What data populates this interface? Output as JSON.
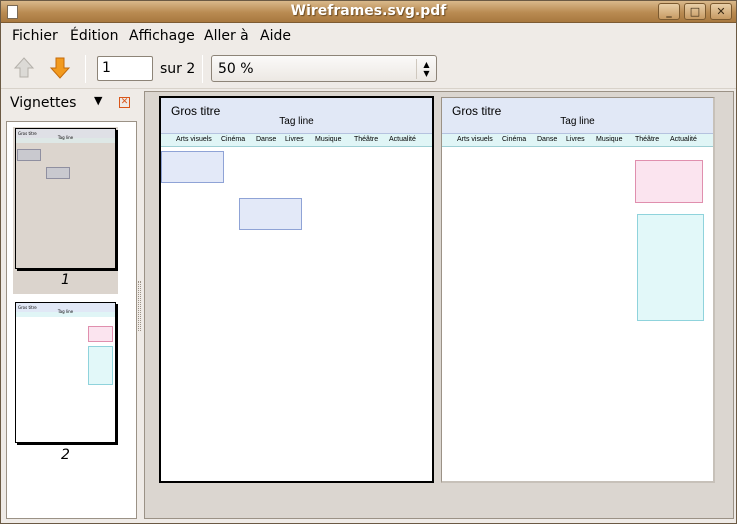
{
  "window": {
    "title": "Wireframes.svg.pdf",
    "controls": {
      "minimize": "_",
      "maximize": "□",
      "close": "✕"
    }
  },
  "menubar": {
    "items": [
      {
        "label": "Fichier"
      },
      {
        "label": "Édition"
      },
      {
        "label": "Affichage"
      },
      {
        "label": "Aller à"
      },
      {
        "label": "Aide"
      }
    ]
  },
  "toolbar": {
    "prev_icon": "up-arrow-icon",
    "next_icon": "down-arrow-icon",
    "page_value": "1",
    "page_total": "sur 2",
    "zoom_value": "50 %"
  },
  "sidebar": {
    "title": "Vignettes",
    "thumbnails": [
      {
        "number": "1",
        "selected": true
      },
      {
        "number": "2",
        "selected": false
      }
    ]
  },
  "document": {
    "pages": [
      {
        "title": "Gros titre",
        "tagline": "Tag line",
        "nav": [
          "Arts visuels",
          "Cinéma",
          "Danse",
          "Livres",
          "Musique",
          "Théâtre",
          "Actualité"
        ]
      },
      {
        "title": "Gros titre",
        "tagline": "Tag line",
        "nav": [
          "Arts visuels",
          "Cinéma",
          "Danse",
          "Livres",
          "Musique",
          "Théâtre",
          "Actualité"
        ]
      }
    ]
  },
  "colors": {
    "titlebar": "#b98b52",
    "header_fill": "#e1e8f6",
    "nav_fill": "#e0f5f6",
    "pink_box": "#fbe4ef",
    "cyan_box": "#e2f8f9",
    "close_icon": "#d9561a"
  }
}
